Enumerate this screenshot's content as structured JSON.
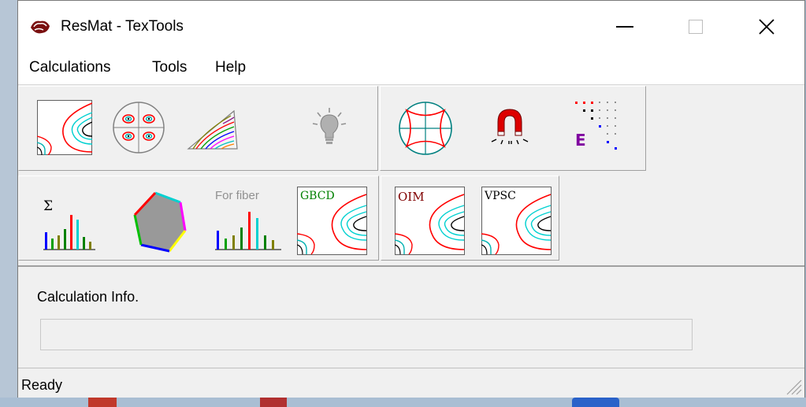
{
  "window": {
    "title": "ResMat - TexTools",
    "minimize_symbol": "—",
    "close_symbol": "✕"
  },
  "menu": [
    {
      "label": "Calculations"
    },
    {
      "label": "Tools"
    },
    {
      "label": "Help"
    }
  ],
  "toolbar": {
    "row1": [
      {
        "name": "odf-contour-button",
        "icon": "odf-contour-icon"
      },
      {
        "name": "pole-figure-button",
        "icon": "pole-figure-icon"
      },
      {
        "name": "inverse-pole-figure-button",
        "icon": "inverse-pole-figure-icon"
      },
      {
        "name": "lightbulb-button",
        "icon": "lightbulb-icon"
      },
      {
        "name": "stereographic-net-button",
        "icon": "stereographic-net-icon"
      },
      {
        "name": "magnet-button",
        "icon": "magnet-icon"
      },
      {
        "name": "elastic-dots-button",
        "icon": "elastic-e-icon",
        "letter": "E"
      }
    ],
    "row2": [
      {
        "name": "sum-histogram-button",
        "icon": "sigma-histogram-icon",
        "text": "Σ"
      },
      {
        "name": "polygon-button",
        "icon": "hexagon-icon"
      },
      {
        "name": "fiber-histogram-button",
        "icon": "fiber-histogram-icon",
        "text": "For fiber"
      },
      {
        "name": "gbcd-button",
        "icon": "gbcd-contour-icon",
        "text": "GBCD"
      },
      {
        "name": "oim-button",
        "icon": "oim-contour-icon",
        "text": "OIM"
      },
      {
        "name": "vpsc-button",
        "icon": "vpsc-contour-icon",
        "text": "VPSC"
      }
    ]
  },
  "info": {
    "label": "Calculation Info.",
    "progress": 0
  },
  "status": {
    "text": "Ready"
  },
  "colors": {
    "contour_red": "#ff0000",
    "contour_cyan": "#00e0e0",
    "gbcd_green": "#008000",
    "oim_maroon": "#800000",
    "vpsc_text": "#000080"
  }
}
